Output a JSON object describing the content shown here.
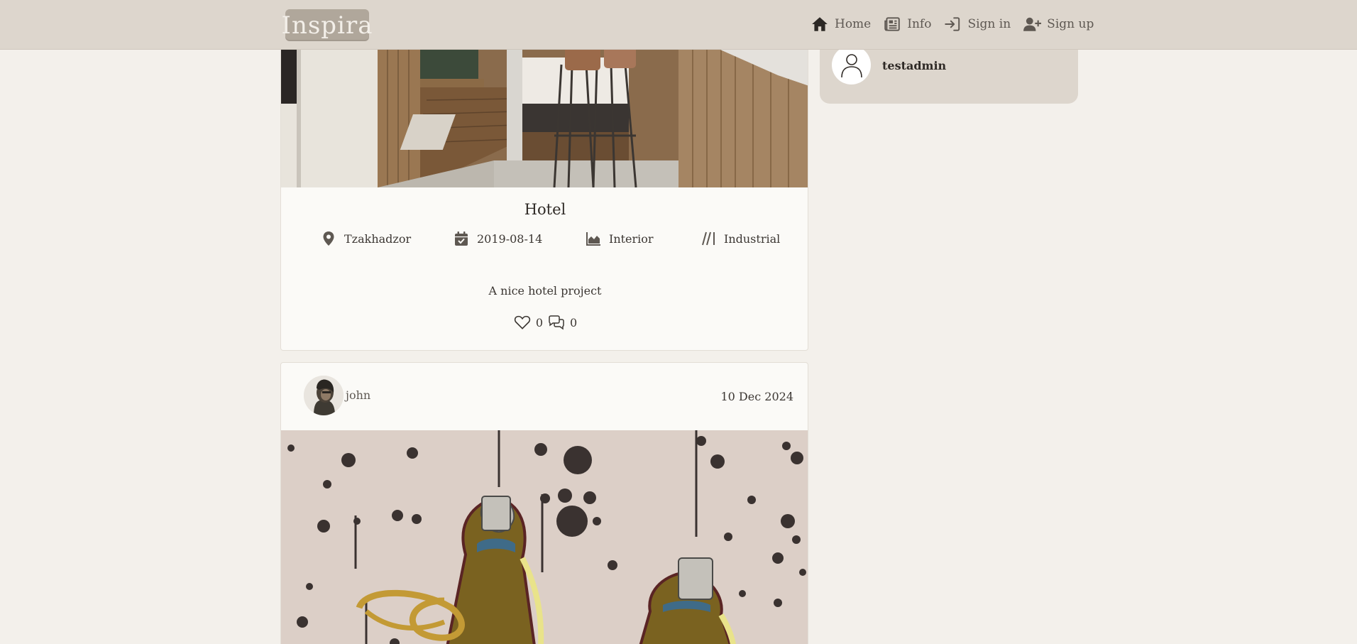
{
  "nav": {
    "logo_text": "Inspira",
    "links": [
      {
        "label": "Home",
        "icon": "home-icon"
      },
      {
        "label": "Info",
        "icon": "newspaper-icon"
      },
      {
        "label": "Sign in",
        "icon": "sign-in-icon"
      },
      {
        "label": "Sign up",
        "icon": "user-plus-icon"
      }
    ]
  },
  "sidebar": {
    "username": "testadmin"
  },
  "post1": {
    "title": "Hotel",
    "location": "Tzakhadzor",
    "date": "2019-08-14",
    "category": "Interior",
    "style": "Industrial",
    "description": "A nice hotel project",
    "likes": "0",
    "comments": "0"
  },
  "post2": {
    "author": "john",
    "date": "10 Dec 2024"
  },
  "colors": {
    "navbar": "#ddd6cd",
    "background": "#f3f0eb",
    "card": "#fbfaf7",
    "logo_bg": "#b0a79b",
    "text": "#3b3632",
    "muted": "#5e5852"
  }
}
